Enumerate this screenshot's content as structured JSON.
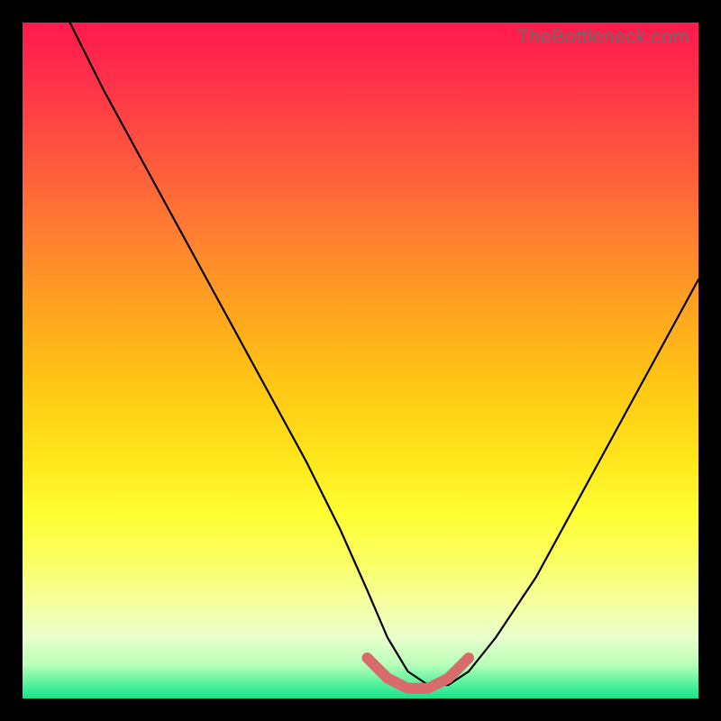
{
  "watermark": "TheBottleneck.com",
  "chart_data": {
    "type": "line",
    "title": "",
    "xlabel": "",
    "ylabel": "",
    "xlim": [
      0,
      100
    ],
    "ylim": [
      0,
      100
    ],
    "series": [
      {
        "name": "bottleneck-curve",
        "x": [
          7,
          12,
          18,
          24,
          30,
          36,
          42,
          47,
          51,
          54,
          57,
          60,
          63,
          66,
          70,
          76,
          82,
          88,
          94,
          100
        ],
        "y": [
          100,
          90,
          79,
          68,
          57,
          46,
          35,
          25,
          16,
          9,
          4,
          2,
          2,
          4,
          9,
          18,
          29,
          40,
          51,
          62
        ]
      }
    ],
    "annotations": [
      {
        "name": "flat-bottom-highlight",
        "x": [
          51,
          54,
          57,
          60,
          63,
          66
        ],
        "y": [
          6,
          3,
          1.5,
          1.5,
          3,
          6
        ]
      }
    ]
  }
}
